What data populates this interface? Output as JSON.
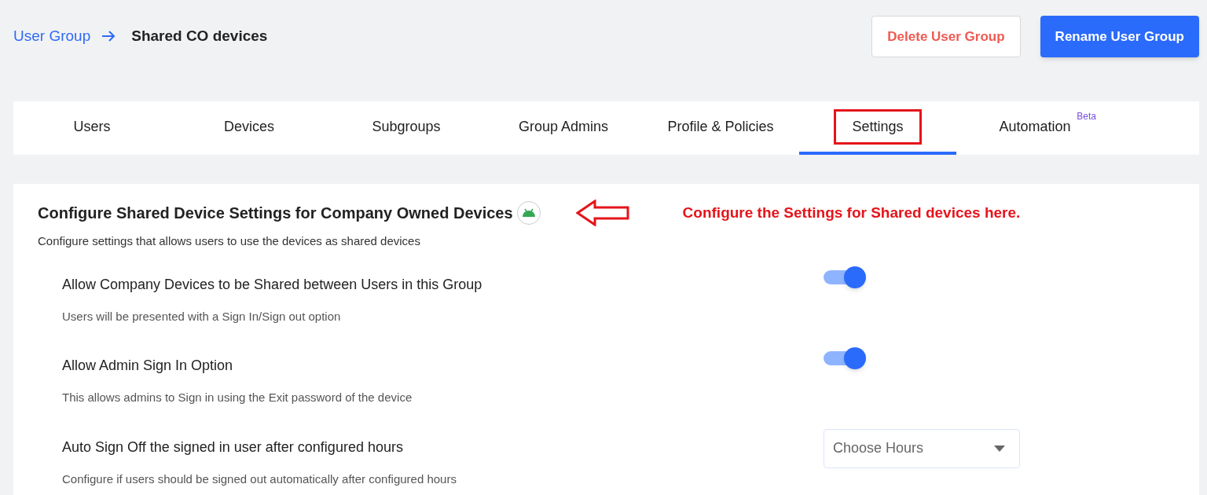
{
  "breadcrumb": {
    "parent": "User Group",
    "current": "Shared CO devices"
  },
  "actions": [
    {
      "label": "Delete User Group",
      "kind": "danger"
    },
    {
      "label": "Rename User Group",
      "kind": "primary"
    }
  ],
  "tabs": [
    {
      "label": "Users",
      "selected": false,
      "highlighted": false
    },
    {
      "label": "Devices",
      "selected": false,
      "highlighted": false
    },
    {
      "label": "Subgroups",
      "selected": false,
      "highlighted": false
    },
    {
      "label": "Group Admins",
      "selected": false,
      "highlighted": false
    },
    {
      "label": "Profile & Policies",
      "selected": false,
      "highlighted": false
    },
    {
      "label": "Settings",
      "selected": true,
      "highlighted": true
    },
    {
      "label": "Automation",
      "selected": false,
      "highlighted": false,
      "badge": "Beta"
    }
  ],
  "section": {
    "title": "Configure Shared Device Settings for Company Owned Devices",
    "description": "Configure settings that allows users to use the devices as shared devices"
  },
  "annotation": {
    "text": "Configure the Settings for Shared devices here."
  },
  "settings": [
    {
      "kind": "toggle",
      "title": "Allow Company Devices to be Shared between Users in this Group",
      "description": "Users will be presented with a Sign In/Sign out option",
      "on": true
    },
    {
      "kind": "toggle",
      "title": "Allow Admin Sign In Option",
      "description": "This allows admins to Sign in using the Exit password of the device",
      "on": true
    },
    {
      "kind": "dropdown",
      "title": "Auto Sign Off the signed in user after configured hours",
      "description": "Configure if users should be signed out automatically after configured hours",
      "placeholder": "Choose Hours"
    }
  ]
}
